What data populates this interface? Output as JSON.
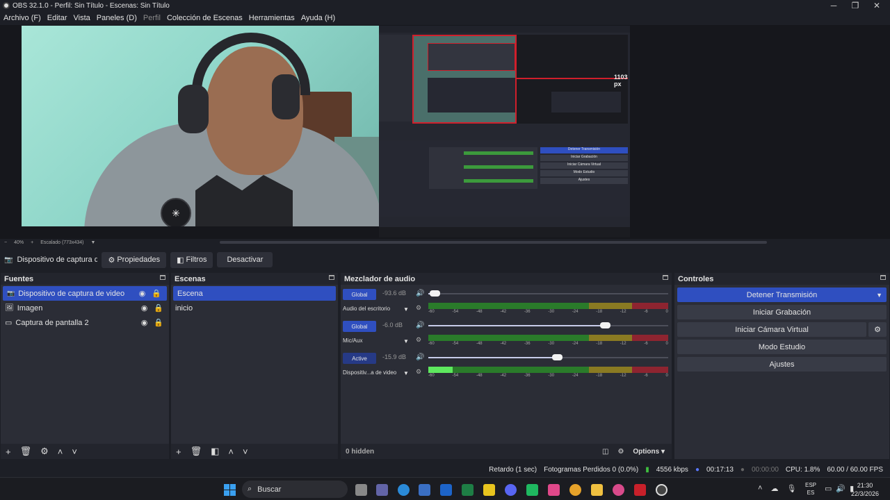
{
  "window": {
    "title": "OBS 32.1.0 - Perfil: Sin Título - Escenas: Sin Título"
  },
  "menu": [
    "Archivo (F)",
    "Editar",
    "Vista",
    "Paneles (D)",
    "Perfil",
    "Colección de Escenas",
    "Herramientas",
    "Ayuda (H)"
  ],
  "preview": {
    "nested_label": "1103 px",
    "zoom": "40%",
    "scaled": "Escalado (773x434)",
    "nested_buttons": [
      "Detener Transmisión",
      "Iniciar Grabación",
      "Iniciar Cámara Virtual",
      "Modo Estudio",
      "Ajustes"
    ]
  },
  "source_toolbar": {
    "selected": "Dispositivo de captura de v",
    "properties": "Propiedades",
    "filters": "Filtros",
    "deactivate": "Desactivar"
  },
  "sources": {
    "title": "Fuentes",
    "items": [
      {
        "label": "Dispositivo de captura de video",
        "selected": true
      },
      {
        "label": "Imagen",
        "selected": false
      },
      {
        "label": "Captura de pantalla 2",
        "selected": false
      }
    ]
  },
  "scenes": {
    "title": "Escenas",
    "items": [
      {
        "label": "Escena",
        "selected": true
      },
      {
        "label": "inicio",
        "selected": false
      }
    ]
  },
  "mixer": {
    "title": "Mezclador de audio",
    "channels": [
      {
        "tag": "Global",
        "db": "-93.6 dB",
        "name": "Audio del escritorio",
        "volume": 0.03,
        "level": 0.0
      },
      {
        "tag": "Global",
        "db": "-6.0 dB",
        "name": "Mic/Aux",
        "volume": 0.74,
        "level": 0.0
      },
      {
        "tag": "Active",
        "db": "-15.9 dB",
        "name": "Dispositiv...a de video",
        "volume": 0.54,
        "level": 0.1
      }
    ],
    "scale": [
      "-60",
      "-54",
      "-48",
      "-42",
      "-36",
      "-30",
      "-24",
      "-18",
      "-12",
      "-6",
      "0"
    ],
    "hidden": "0 hidden",
    "options": "Options"
  },
  "controls": {
    "title": "Controles",
    "buttons": [
      "Detener Transmisión",
      "Iniciar Grabación",
      "Iniciar Cámara Virtual",
      "Modo Estudio",
      "Ajustes"
    ]
  },
  "status": {
    "delay": "Retardo (1 sec)",
    "dropped": "Fotogramas Perdidos 0 (0.0%)",
    "bitrate": "4556 kbps",
    "stream_time": "00:17:13",
    "record_time": "00:00:00",
    "cpu": "CPU: 1.8%",
    "fps": "60.00 / 60.00 FPS"
  },
  "taskbar": {
    "search": "Buscar",
    "lang": "ESP",
    "lang2": "ES",
    "time": "21:30",
    "date": "22/3/2026"
  },
  "colors": {
    "accent": "#2f4fc0",
    "bg": "#1d1f26",
    "panel": "#2b2d36"
  }
}
